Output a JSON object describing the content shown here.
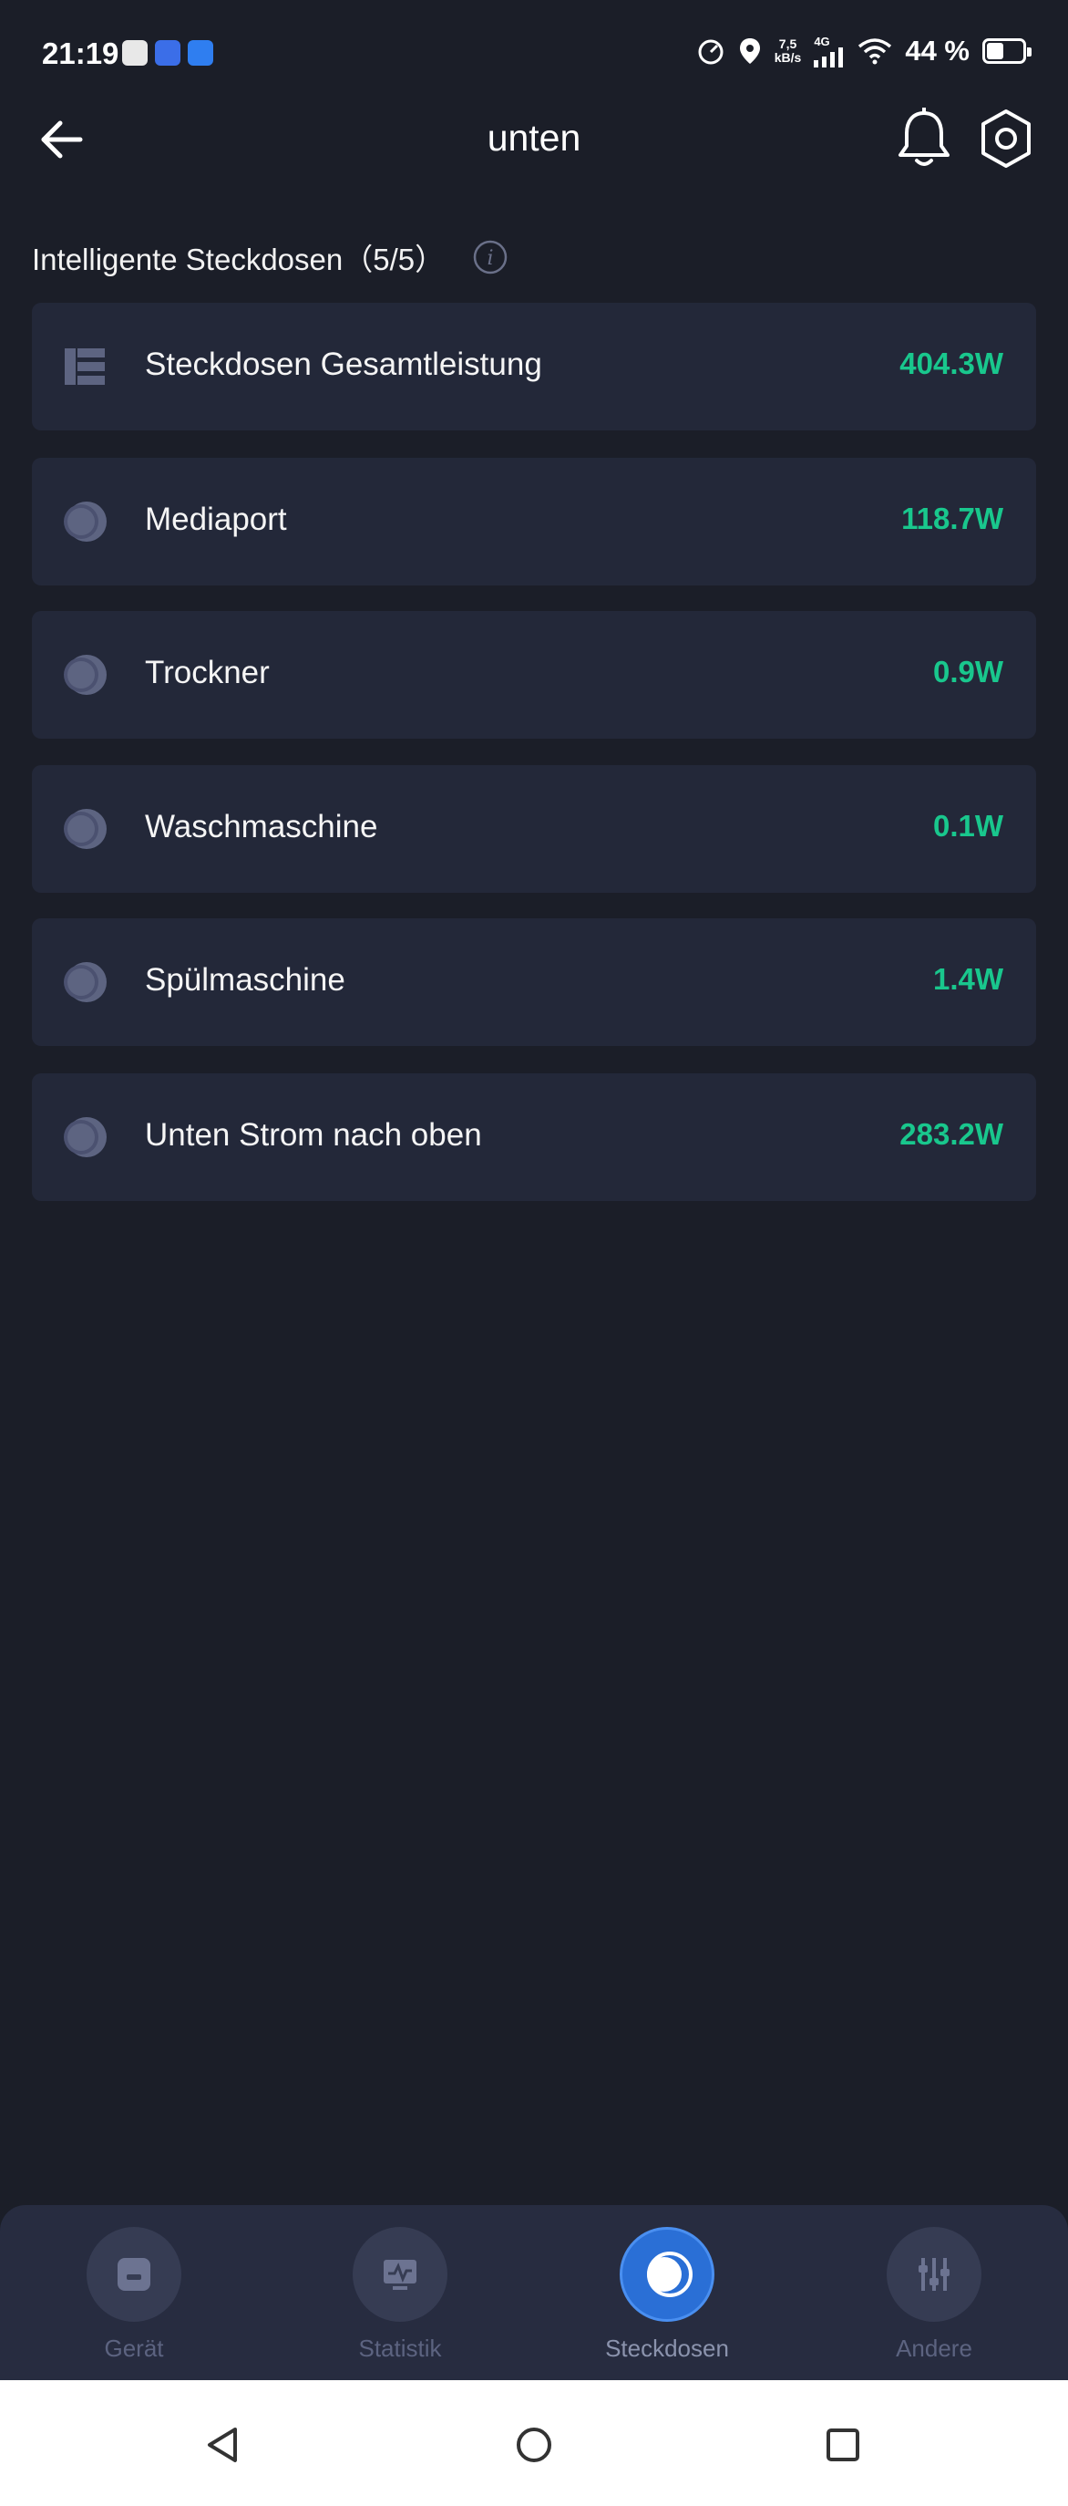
{
  "status_bar": {
    "time": "21:19",
    "net_speed_value": "7,5",
    "net_speed_unit": "kB/s",
    "network_type": "4G",
    "battery_text": "44 %",
    "battery_level": 0.44
  },
  "header": {
    "title": "unten",
    "back_icon": "arrow-left-icon",
    "bell_icon": "bell-icon",
    "settings_icon": "hexagon-gear-icon"
  },
  "section": {
    "title": "Intelligente Steckdosen（5/5）",
    "info_icon": "info-icon"
  },
  "sockets": [
    {
      "label": "Steckdosen Gesamtleistung",
      "value": "404.3W",
      "icon": "power-strip-icon"
    },
    {
      "label": "Mediaport",
      "value": "118.7W",
      "icon": "plug-icon"
    },
    {
      "label": "Trockner",
      "value": "0.9W",
      "icon": "plug-icon"
    },
    {
      "label": "Waschmaschine",
      "value": "0.1W",
      "icon": "plug-icon"
    },
    {
      "label": "Spülmaschine",
      "value": "1.4W",
      "icon": "plug-icon"
    },
    {
      "label": "Unten Strom nach oben",
      "value": "283.2W",
      "icon": "plug-icon"
    }
  ],
  "bottom_nav": {
    "items": [
      {
        "label": "Gerät",
        "icon": "device-icon",
        "active": false
      },
      {
        "label": "Statistik",
        "icon": "statistics-icon",
        "active": false
      },
      {
        "label": "Steckdosen",
        "icon": "plug-icon",
        "active": true
      },
      {
        "label": "Andere",
        "icon": "sliders-icon",
        "active": false
      }
    ]
  },
  "colors": {
    "background": "#1b1e28",
    "card": "#232839",
    "value_green": "#19c78d",
    "nav_background": "#272c40",
    "active_blue": "#2a6fd6"
  }
}
